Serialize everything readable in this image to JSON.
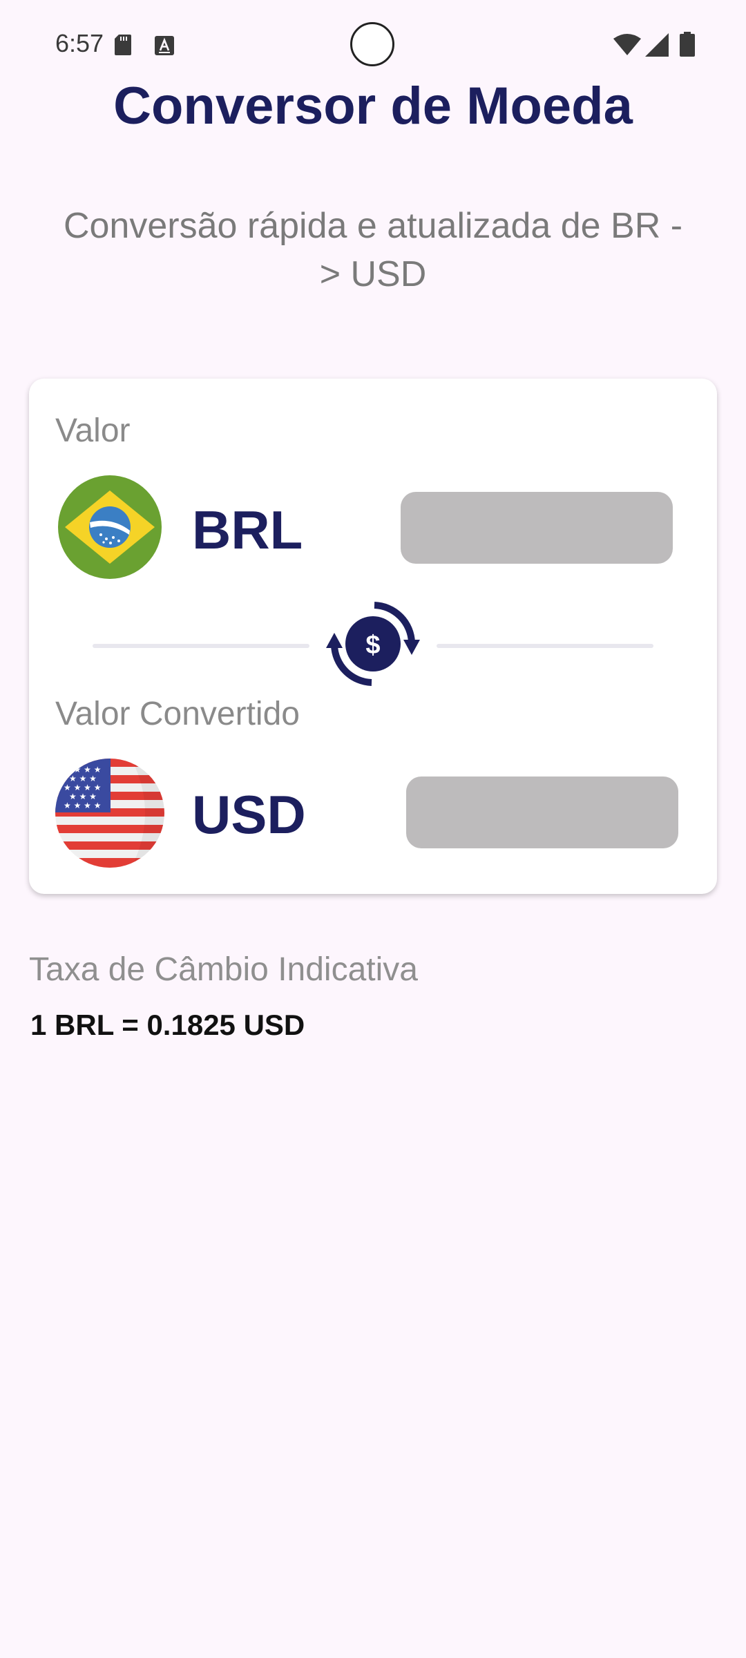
{
  "status_bar": {
    "time": "6:57",
    "icons": [
      "sd-card-icon",
      "a-notification-icon",
      "wifi-icon",
      "signal-icon",
      "battery-icon"
    ]
  },
  "header": {
    "title": "Conversor de Moeda",
    "subtitle": "Conversão rápida e atualizada de BR -> USD"
  },
  "converter": {
    "from": {
      "label": "Valor",
      "currency": "BRL",
      "flag": "brazil-flag-icon",
      "value": "",
      "placeholder": ""
    },
    "swap_icon": "currency-exchange-icon",
    "to": {
      "label": "Valor Convertido",
      "currency": "USD",
      "flag": "usa-flag-icon",
      "value": "",
      "placeholder": ""
    }
  },
  "rate": {
    "label": "Taxa de Câmbio Indicativa",
    "value": "1 BRL = 0.1825 USD"
  },
  "colors": {
    "background": "#fdf6fd",
    "primary": "#1c1f5e",
    "muted_text": "#8a8a8a",
    "input_background": "#bdbbbc",
    "card": "#ffffff"
  }
}
